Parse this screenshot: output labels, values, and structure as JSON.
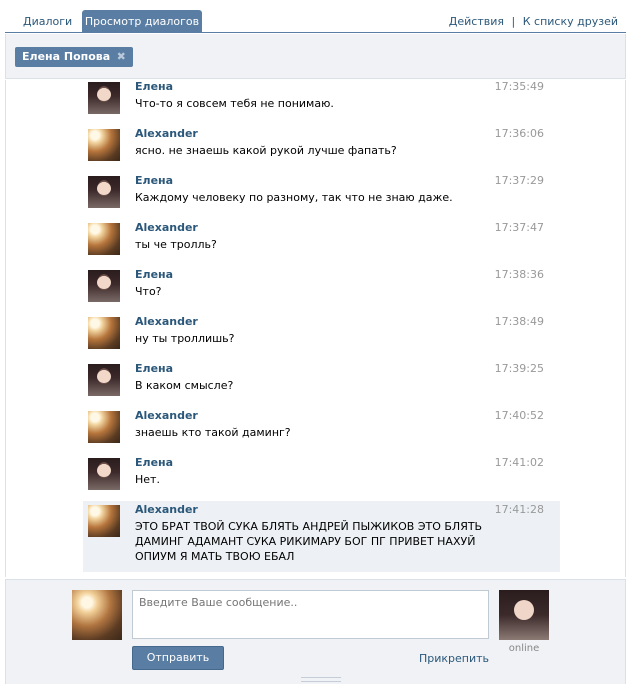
{
  "tabs": {
    "dialogs": "Диалоги",
    "view": "Просмотр диалогов"
  },
  "top_links": {
    "actions": "Действия",
    "separator": "|",
    "friends": "К списку друзей"
  },
  "peer": {
    "name": "Елена Попова",
    "remove": "✖"
  },
  "messages": [
    {
      "author": "Елена",
      "text": "Что-то я совсем тебя не понимаю.",
      "time": "17:35:49",
      "avatar": "elena-avatar"
    },
    {
      "author": "Alexander",
      "text": "ясно. не знаешь какой рукой лучше фапать?",
      "time": "17:36:06",
      "avatar": "alexander-avatar"
    },
    {
      "author": "Елена",
      "text": "Каждому человеку по разному, так что не знаю даже.",
      "time": "17:37:29",
      "avatar": "elena-avatar"
    },
    {
      "author": "Alexander",
      "text": "ты че тролль?",
      "time": "17:37:47",
      "avatar": "alexander-avatar"
    },
    {
      "author": "Елена",
      "text": "Что?",
      "time": "17:38:36",
      "avatar": "elena-avatar"
    },
    {
      "author": "Alexander",
      "text": "ну ты троллишь?",
      "time": "17:38:49",
      "avatar": "alexander-avatar"
    },
    {
      "author": "Елена",
      "text": "В каком смысле?",
      "time": "17:39:25",
      "avatar": "elena-avatar"
    },
    {
      "author": "Alexander",
      "text": "знаешь кто такой даминг?",
      "time": "17:40:52",
      "avatar": "alexander-avatar"
    },
    {
      "author": "Елена",
      "text": "Нет.",
      "time": "17:41:02",
      "avatar": "elena-avatar"
    },
    {
      "author": "Alexander",
      "text": "ЭТО БРАТ ТВОЙ СУКА БЛЯТЬ АНДРЕЙ ПЫЖИКОВ ЭТО БЛЯТЬ ДАМИНГ АДАМАНТ СУКА РИКИМАРУ БОГ ПГ ПРИВЕТ НАХУЙ ОПИУМ Я МАТЬ ТВОЮ ЕБАЛ",
      "time": "17:41:28",
      "avatar": "alexander-avatar"
    }
  ],
  "composer": {
    "placeholder": "Введите Ваше сообщение..",
    "send": "Отправить",
    "attach": "Прикрепить",
    "status": "online"
  },
  "colors": {
    "accent": "#597da3",
    "link": "#2b587a",
    "panel": "#f0f2f5",
    "highlight": "#edf1f5"
  }
}
